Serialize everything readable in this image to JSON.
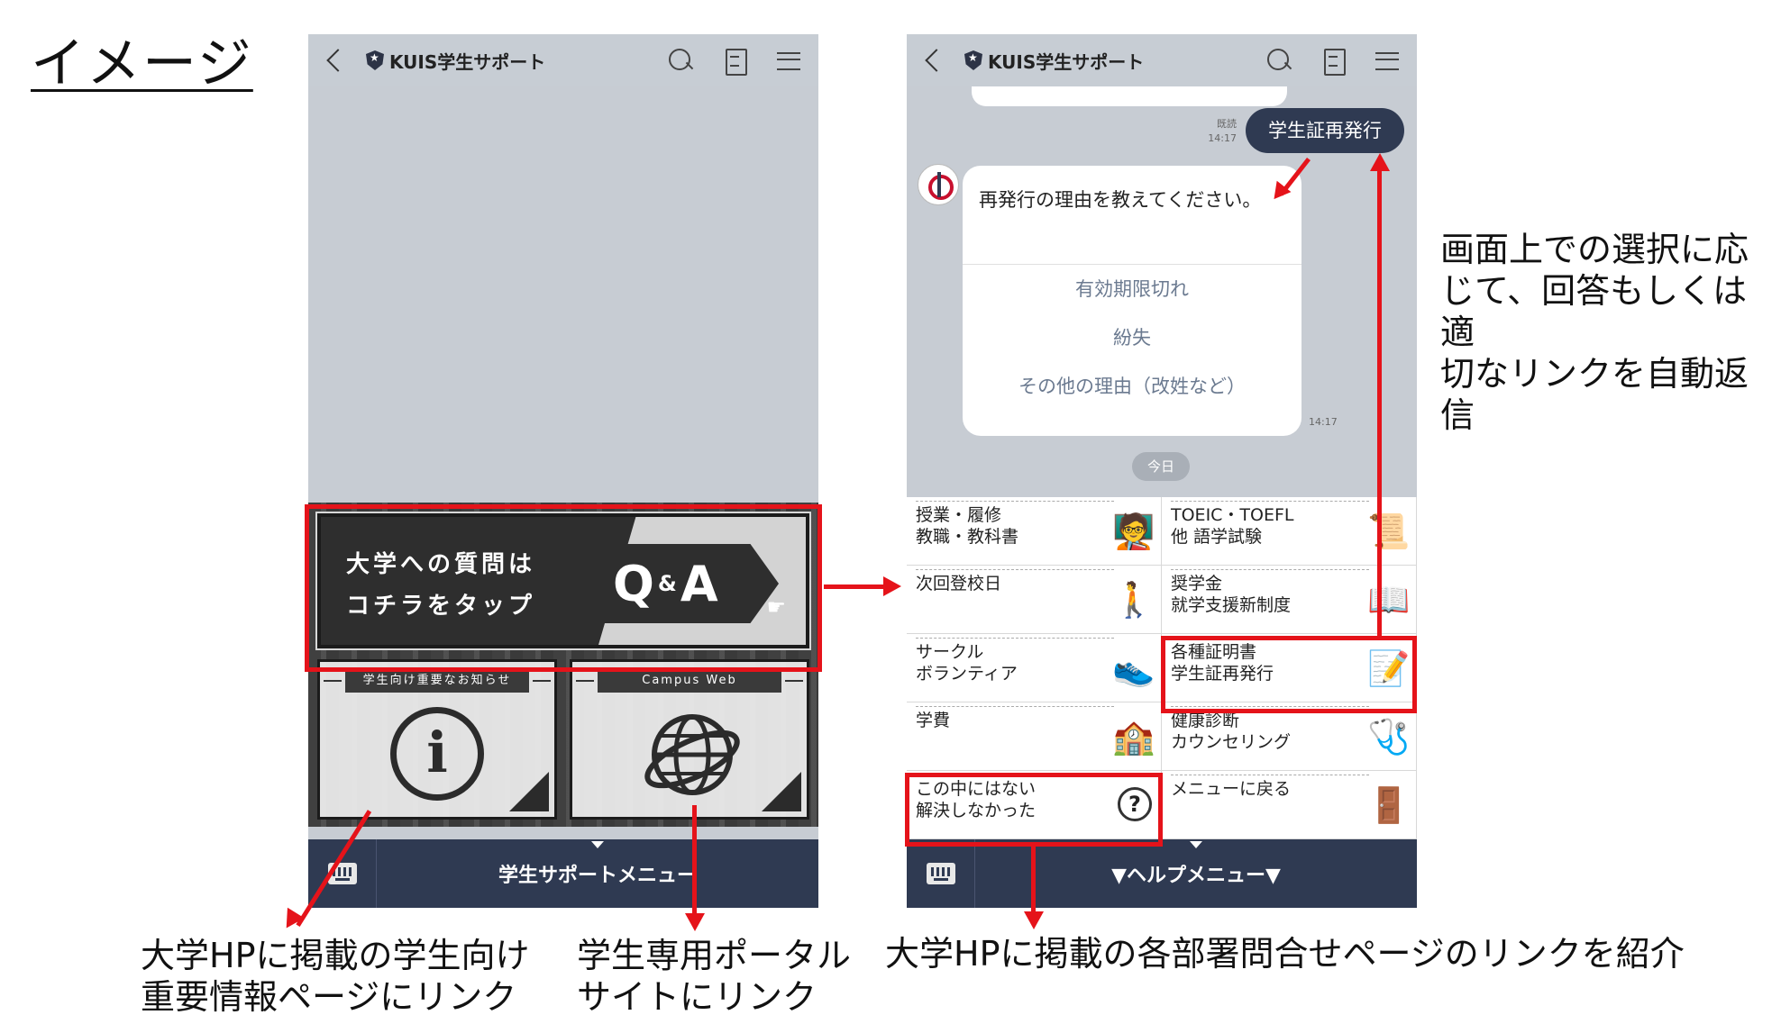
{
  "slide_title": "イメージ",
  "left_phone": {
    "ghost_text": "",
    "topbar_title": "KUIS学生サポート",
    "qa_line1": "大学への質問は",
    "qa_line2": "コチラをタップ",
    "qa_q": "Q",
    "qa_amp": "&",
    "qa_a": "A",
    "info_label": "学生向け重要なお知らせ",
    "info_glyph": "i",
    "web_label": "Campus Web",
    "bottom_label": "学生サポートメニュー"
  },
  "right_phone": {
    "topbar_title": "KUIS学生サポート",
    "user_message": "学生証再発行",
    "read_label": "既読",
    "read_time": "14:17",
    "bot_question": "再発行の理由を教えてください。",
    "options": [
      "有効期限切れ",
      "紛失",
      "その他の理由（改姓など）"
    ],
    "bot_time": "14:17",
    "today": "今日",
    "menu_items": [
      {
        "line1": "授業・履修",
        "line2": "教職・教科書",
        "icon": "teacher-icon"
      },
      {
        "line1": "TOEIC・TOEFL",
        "line2": "他 語学試験",
        "icon": "certificate-icon"
      },
      {
        "line1": "次回登校日",
        "line2": "",
        "icon": "walking-person-icon"
      },
      {
        "line1": "奨学金",
        "line2": "就学支援新制度",
        "icon": "book-pen-icon"
      },
      {
        "line1": "サークル",
        "line2": "ボランティア",
        "icon": "shoe-icon"
      },
      {
        "line1": "各種証明書",
        "line2": "学生証再発行",
        "icon": "document-pen-icon"
      },
      {
        "line1": "学費",
        "line2": "",
        "icon": "building-icon"
      },
      {
        "line1": "健康診断",
        "line2": "カウンセリング",
        "icon": "stethoscope-icon"
      },
      {
        "line1": "この中にはない",
        "line2": "解決しなかった",
        "icon": "question-icon"
      },
      {
        "line1": "メニューに戻る",
        "line2": "",
        "icon": "exit-icon"
      }
    ],
    "bottom_label": "▼ヘルプメニュー▼"
  },
  "annotations": {
    "right_note": [
      "画面上での選択に応",
      "じて、回答もしくは適",
      "切なリンクを自動返信"
    ],
    "caption_info": [
      "大学HPに掲載の学生向け",
      "重要情報ページにリンク"
    ],
    "caption_portal": [
      "学生専用ポータル",
      "サイトにリンク"
    ],
    "caption_depts": "大学HPに掲載の各部署問合せページのリンクを紹介"
  },
  "colors": {
    "accent_red": "#e5131a",
    "navy": "#2f3a52",
    "chat_bg": "#c7ccd3"
  }
}
